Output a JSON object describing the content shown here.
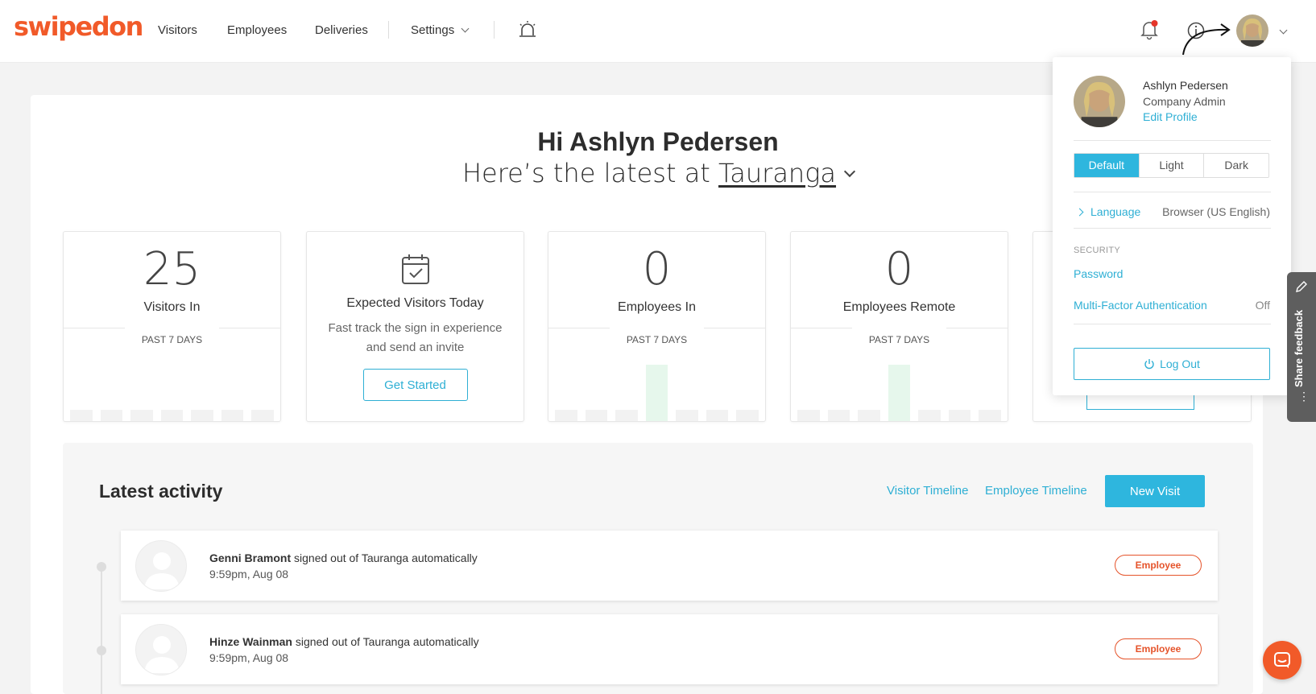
{
  "brand": {
    "logo_text": "swipedon",
    "color": "#f15a29",
    "accent": "#2eb6de"
  },
  "nav": {
    "items": [
      {
        "label": "Visitors"
      },
      {
        "label": "Employees"
      },
      {
        "label": "Deliveries"
      },
      {
        "label": "Settings"
      }
    ]
  },
  "header_icons": [
    "bell-icon",
    "info-icon",
    "user-avatar",
    "chevron-down-icon",
    "alarm-siren-icon"
  ],
  "greeting": {
    "title": "Hi Ashlyn Pedersen",
    "subtitle_prefix": "Here’s the latest at",
    "location": "Tauranga"
  },
  "stats": [
    {
      "value": "25",
      "label": "Visitors In",
      "period": "PAST 7 DAYS"
    },
    {
      "label": "Expected Visitors Today",
      "description_line1": "Fast track the sign in experience",
      "description_line2": "and send an invite",
      "button": "Get Started"
    },
    {
      "value": "0",
      "label": "Employees In",
      "period": "PAST 7 DAYS"
    },
    {
      "value": "0",
      "label": "Employees Remote",
      "period": "PAST 7 DAYS"
    }
  ],
  "activity": {
    "title": "Latest activity",
    "visitor_timeline": "Visitor Timeline",
    "employee_timeline": "Employee Timeline",
    "new_visit": "New Visit",
    "rows": [
      {
        "name": "Genni Bramont",
        "action": "signed out of Tauranga automatically",
        "time": "9:59pm, Aug 08",
        "badge": "Employee"
      },
      {
        "name": "Hinze Wainman",
        "action": "signed out of Tauranga automatically",
        "time": "9:59pm, Aug 08",
        "badge": "Employee"
      }
    ]
  },
  "profile_menu": {
    "name": "Ashlyn Pedersen",
    "role": "Company Admin",
    "edit_profile": "Edit Profile",
    "themes": [
      "Default",
      "Light",
      "Dark"
    ],
    "language_label": "Language",
    "language_value": "Browser (US English)",
    "security_heading": "SECURITY",
    "password": "Password",
    "mfa": "Multi-Factor Authentication",
    "mfa_value": "Off",
    "logout": "Log Out"
  },
  "feedback": {
    "label": "Share feedback"
  }
}
